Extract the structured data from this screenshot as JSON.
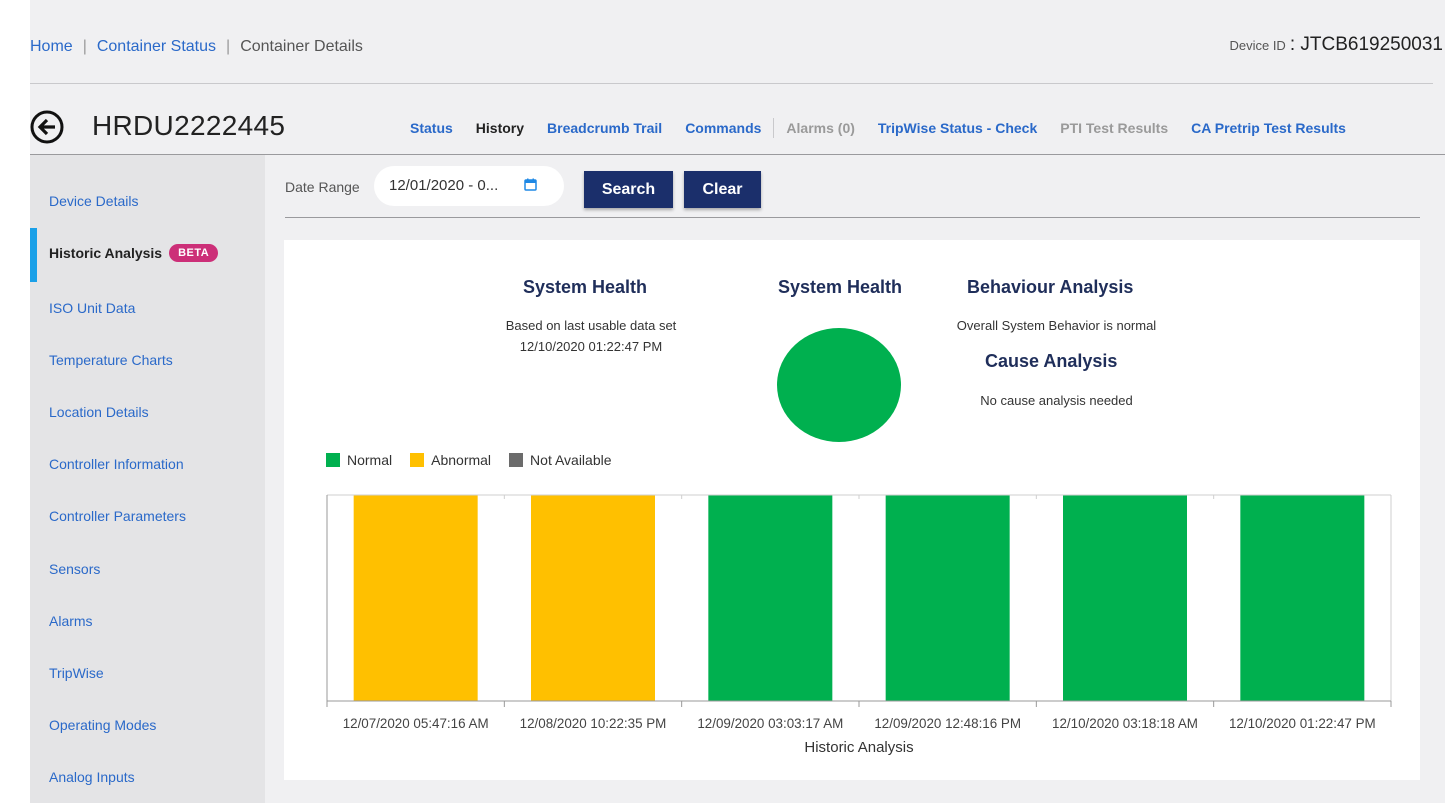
{
  "breadcrumb": {
    "home": "Home",
    "status": "Container Status",
    "current": "Container Details"
  },
  "device": {
    "label": "Device ID",
    "value": ": JTCB619250031"
  },
  "container_id": "HRDU2222445",
  "tabs": [
    {
      "label": "Status",
      "state": "link"
    },
    {
      "label": "History",
      "state": "active"
    },
    {
      "label": "Breadcrumb Trail",
      "state": "link"
    },
    {
      "label": "Commands",
      "state": "link"
    },
    {
      "label": "Alarms (0)",
      "state": "disabled"
    },
    {
      "label": "TripWise Status - Check",
      "state": "link"
    },
    {
      "label": "PTI Test Results",
      "state": "disabled"
    },
    {
      "label": "CA Pretrip Test Results",
      "state": "link"
    }
  ],
  "sidebar": {
    "items": [
      {
        "label": "Device Details"
      },
      {
        "label": "Historic Analysis",
        "badge": "BETA",
        "active": true
      },
      {
        "label": "ISO Unit Data"
      },
      {
        "label": "Temperature Charts"
      },
      {
        "label": "Location Details"
      },
      {
        "label": "Controller Information"
      },
      {
        "label": "Controller Parameters"
      },
      {
        "label": "Sensors"
      },
      {
        "label": "Alarms"
      },
      {
        "label": "TripWise"
      },
      {
        "label": "Operating Modes"
      },
      {
        "label": "Analog Inputs"
      }
    ]
  },
  "filter": {
    "label": "Date Range",
    "value": "12/01/2020 - 0...",
    "search": "Search",
    "clear": "Clear"
  },
  "health": {
    "title": "System Health",
    "sub1": "Based on last usable data set",
    "sub2": "12/10/2020 01:22:47 PM",
    "indicator_title": "System Health",
    "indicator_color": "#00b04f"
  },
  "behaviour": {
    "title": "Behaviour Analysis",
    "text": "Overall System Behavior is normal",
    "cause_title": "Cause Analysis",
    "cause_text": "No cause analysis needed"
  },
  "colors": {
    "Normal": "#00b04f",
    "Abnormal": "#ffc000",
    "Not Available": "#6b6b6b"
  },
  "chart_data": {
    "type": "bar",
    "title": "",
    "xlabel": "Historic Analysis",
    "ylabel": "",
    "legend": [
      "Normal",
      "Abnormal",
      "Not Available"
    ],
    "legend_position": "top-left",
    "categories": [
      "12/07/2020 05:47:16 AM",
      "12/08/2020 10:22:35 PM",
      "12/09/2020 03:03:17 AM",
      "12/09/2020 12:48:16 PM",
      "12/10/2020 03:18:18 AM",
      "12/10/2020 01:22:47 PM"
    ],
    "status": [
      "Abnormal",
      "Abnormal",
      "Normal",
      "Normal",
      "Normal",
      "Normal"
    ],
    "values": [
      1,
      1,
      1,
      1,
      1,
      1
    ],
    "ylim": [
      0,
      1
    ]
  }
}
